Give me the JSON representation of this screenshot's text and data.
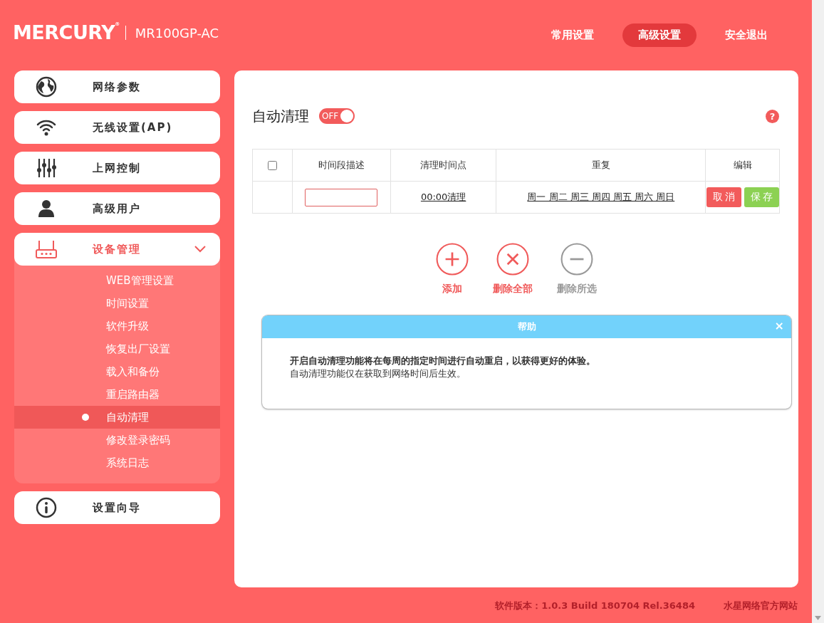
{
  "header": {
    "logo": "MERCURY$^{®}$",
    "model": "MR100GP-AC",
    "nav": [
      {
        "label": "常用设置",
        "selected": false
      },
      {
        "label": "高级设置",
        "selected": true
      },
      {
        "label": "安全退出",
        "selected": false
      }
    ]
  },
  "sidebar": {
    "items": [
      {
        "label": "网络参数",
        "selected": false
      },
      {
        "label": "无线设置(AP)",
        "selected": false
      },
      {
        "label": "上网控制",
        "selected": false
      },
      {
        "label": "高级用户",
        "selected": false
      },
      {
        "label": "设备管理",
        "selected": true,
        "expanded": true,
        "children": [
          {
            "label": "WEB管理设置",
            "selected": false
          },
          {
            "label": "时间设置",
            "selected": false
          },
          {
            "label": "软件升级",
            "selected": false
          },
          {
            "label": "恢复出厂设置",
            "selected": false
          },
          {
            "label": "载入和备份",
            "selected": false
          },
          {
            "label": "重启路由器",
            "selected": false
          },
          {
            "label": "自动清理",
            "selected": true
          },
          {
            "label": "修改登录密码",
            "selected": false
          },
          {
            "label": "系统日志",
            "selected": false
          }
        ]
      },
      {
        "label": "设置向导",
        "selected": false
      }
    ]
  },
  "panel": {
    "title": "自动清理",
    "toggle": {
      "label": "OFF",
      "on": false
    },
    "help_mark": "?",
    "table": {
      "select_all": {
        "checked": false
      },
      "columns": [
        "时间段描述",
        "清理时间点",
        "重复",
        "编辑"
      ],
      "rows": [
        {
          "time": "00:00清理",
          "repeat": "周一 周二 周三 周四 周五 周六 周日",
          "buttons": [
            {
              "label": "取消",
              "kind": "cancel"
            },
            {
              "label": "保存",
              "kind": "save"
            }
          ]
        }
      ]
    },
    "actions": [
      {
        "label": "添加",
        "kind": "add",
        "disabled": false
      },
      {
        "label": "删除全部",
        "kind": "delete_all",
        "disabled": false
      },
      {
        "label": "删除所选",
        "kind": "delete_selected",
        "disabled": true
      }
    ],
    "help": {
      "title": "帮助",
      "close": "×",
      "lines": [
        {
          "text": "开启自动清理功能将在每周的指定时间进行自动重启，以获得更好的体验。",
          "kind": "lead"
        },
        {
          "text": "自动清理功能仅在获取到网络时间后生效。",
          "kind": "note"
        }
      ]
    }
  },
  "footer": {
    "version": "软件版本：1.0.3 Build 180704 Rel.36484",
    "link": "水星网络官方网站"
  }
}
